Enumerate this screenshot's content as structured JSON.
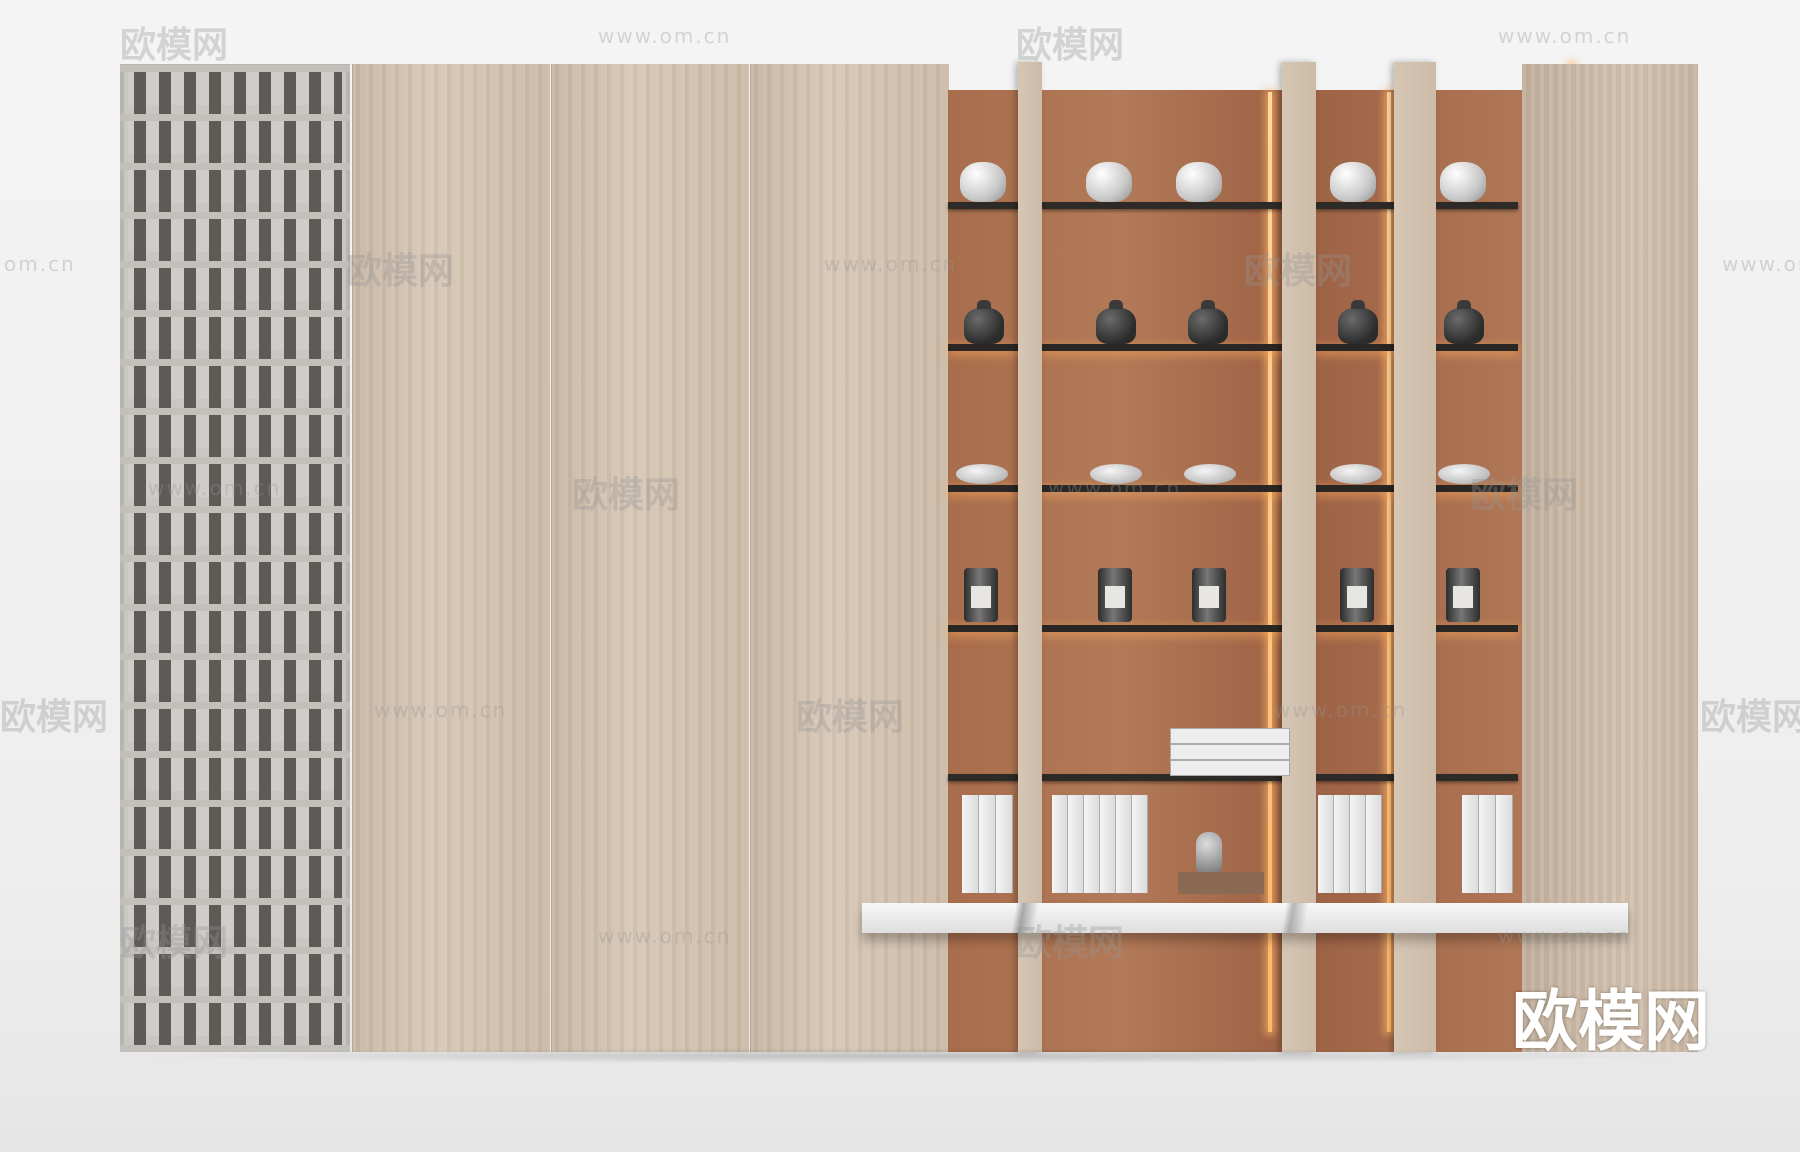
{
  "watermark": {
    "brand": "欧模网",
    "url": "www.om.cn",
    "url_short": "om.cn",
    "corner_brand": "欧模网"
  },
  "colors": {
    "wood": "#d2c1ae",
    "shelf_back": "#a86d4c",
    "led_glow": "#ffb768",
    "lattice": "#c9c7c3",
    "marble": "#ececec"
  }
}
